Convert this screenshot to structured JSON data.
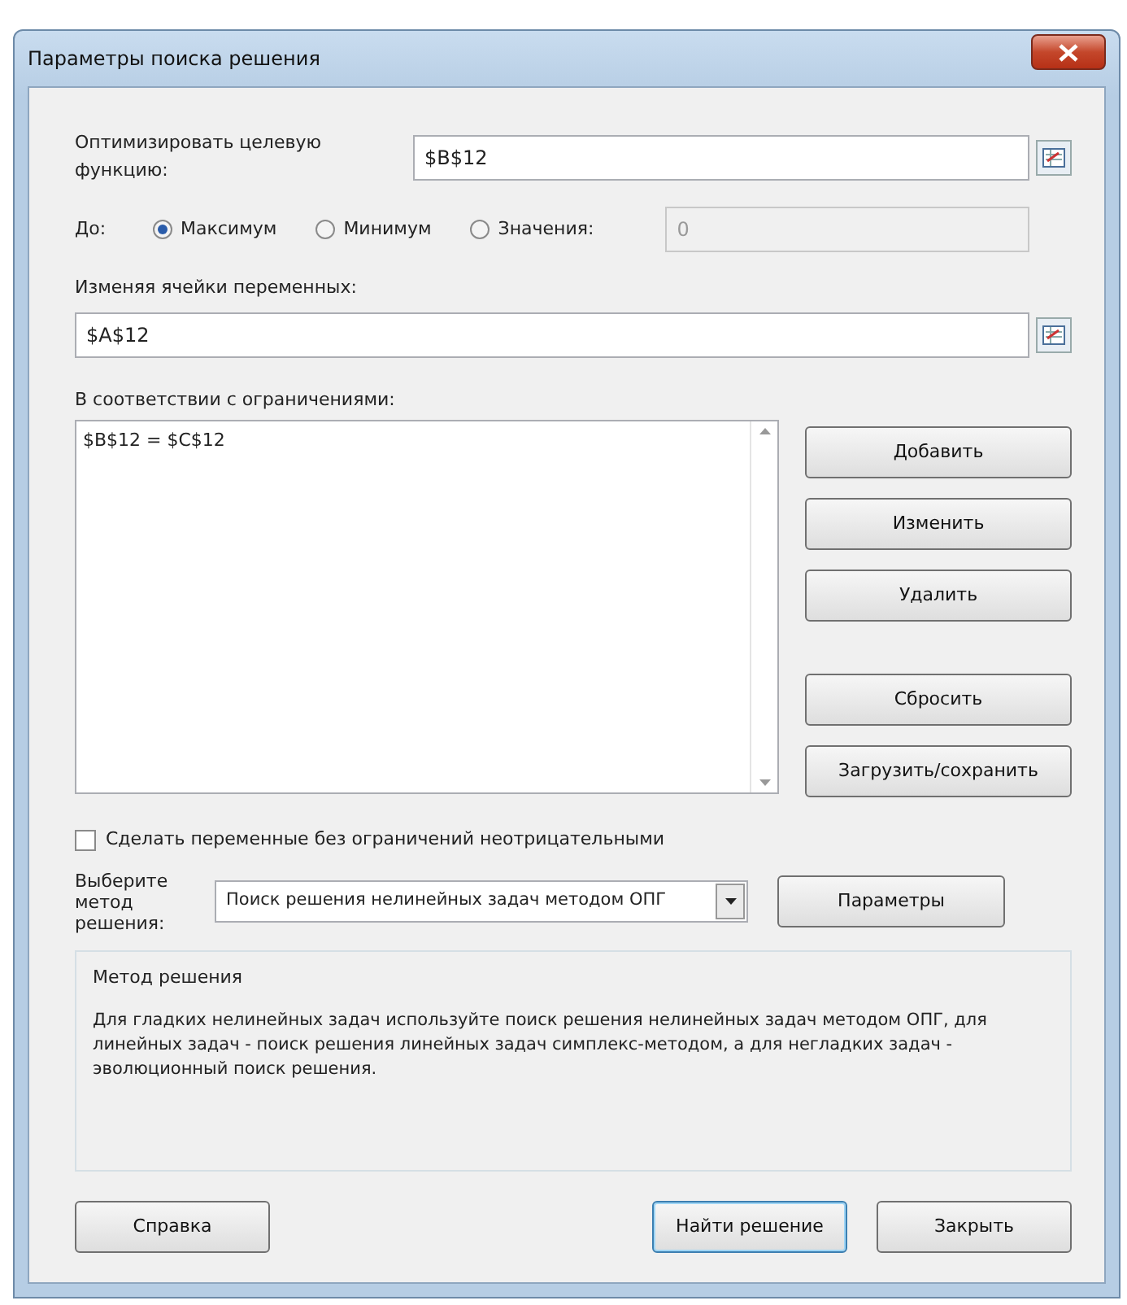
{
  "window": {
    "title": "Параметры поиска решения"
  },
  "objective": {
    "label": "Оптимизировать целевую функцию:",
    "value": "$B$12"
  },
  "target": {
    "label": "До:",
    "options": [
      {
        "label": "Максимум",
        "selected": true
      },
      {
        "label": "Минимум",
        "selected": false
      },
      {
        "label": "Значения:",
        "selected": false
      }
    ],
    "value": "0",
    "disabled": true
  },
  "variables": {
    "label": "Изменяя ячейки переменных:",
    "value": "$A$12"
  },
  "constraints": {
    "label": "В соответствии с ограничениями:",
    "items": [
      "$B$12 = $C$12"
    ],
    "buttons": [
      "Добавить",
      "Изменить",
      "Удалить",
      "Сбросить",
      "Загрузить/сохранить"
    ]
  },
  "nonnegative": {
    "label": "Сделать переменные без ограничений неотрицательными",
    "checked": false
  },
  "method": {
    "label_lines": [
      "Выберите",
      "метод решения:"
    ],
    "value": "Поиск решения нелинейных задач методом ОПГ",
    "button": "Параметры"
  },
  "description": {
    "title": "Метод решения",
    "text": "Для гладких нелинейных задач используйте поиск решения нелинейных задач методом ОПГ, для линейных задач - поиск решения линейных задач симплекс-методом, а для негладких задач - эволюционный поиск решения."
  },
  "footer": [
    {
      "label": "Справка",
      "default": false
    },
    {
      "label": "Найти решение",
      "default": true
    },
    {
      "label": "Закрыть",
      "default": false
    }
  ]
}
